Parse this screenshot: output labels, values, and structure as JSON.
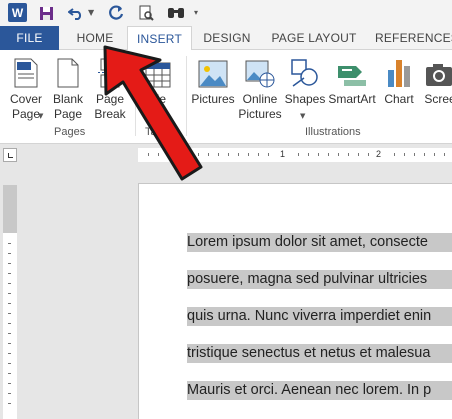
{
  "qat": {
    "icons": [
      "word-logo",
      "save-icon",
      "undo-icon",
      "redo-icon",
      "print-preview-icon",
      "find-icon",
      "customize-icon"
    ],
    "logo_letter": "W"
  },
  "tabs": [
    {
      "label": "FILE",
      "active": false
    },
    {
      "label": "HOME",
      "active": false
    },
    {
      "label": "INSERT",
      "active": true
    },
    {
      "label": "DESIGN",
      "active": false
    },
    {
      "label": "PAGE LAYOUT",
      "active": false
    },
    {
      "label": "REFERENCES",
      "active": false
    }
  ],
  "ribbon": {
    "pages_group": {
      "label": "Pages",
      "buttons": [
        {
          "label": "Cover\nPage",
          "icon": "cover-page-icon",
          "has_dropdown": true
        },
        {
          "label": "Blank\nPage",
          "icon": "blank-page-icon"
        },
        {
          "label": "Page\nBreak",
          "icon": "page-break-icon"
        }
      ]
    },
    "tables_group": {
      "label": "Ta",
      "buttons": [
        {
          "label": "ble",
          "icon": "table-icon"
        }
      ]
    },
    "illustrations_group": {
      "label": "Illustrations",
      "buttons": [
        {
          "label": "Pictures",
          "icon": "pictures-icon"
        },
        {
          "label": "Online\nPictures",
          "icon": "online-pictures-icon"
        },
        {
          "label": "Shapes",
          "icon": "shapes-icon",
          "has_dropdown": true
        },
        {
          "label": "SmartArt",
          "icon": "smartart-icon"
        },
        {
          "label": "Chart",
          "icon": "chart-icon"
        },
        {
          "label": "Scree",
          "icon": "screenshot-icon"
        }
      ]
    }
  },
  "ruler": {
    "numbers": [
      "1",
      "2"
    ]
  },
  "document": {
    "lines": [
      "Lorem ipsum dolor sit amet, consecte",
      "posuere, magna sed pulvinar ultricies",
      "quis urna. Nunc viverra imperdiet enin",
      "tristique senectus et netus et malesua",
      "Mauris et orci. Aenean nec lorem. In p"
    ],
    "selection_color": "#c8c8c8"
  },
  "colors": {
    "accent": "#2b579a",
    "arrow": "#e41b17"
  }
}
